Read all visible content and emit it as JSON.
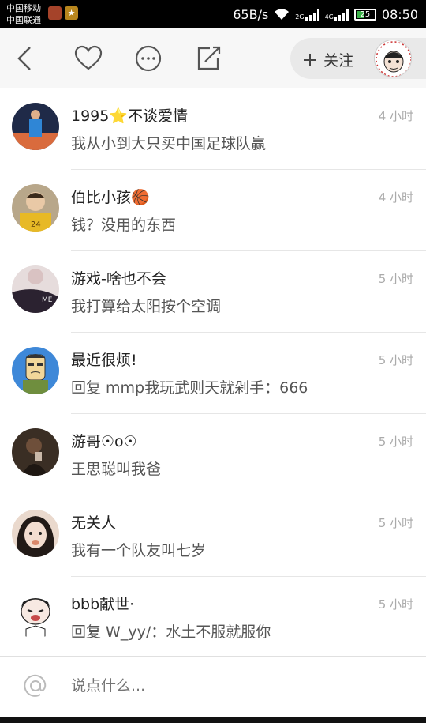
{
  "status_bar": {
    "carrier1": "中国移动",
    "carrier2": "中国联通",
    "speed": "65B/s",
    "net1": "2G",
    "net2": "4G",
    "battery": "25",
    "time": "08:50"
  },
  "header": {
    "follow_label": "关注"
  },
  "comments": [
    {
      "name": "1995⭐不谈爱情",
      "time": "4 小时",
      "message": "我从小到大只买中国足球队赢",
      "avatar_colors": [
        "#3b5a8a",
        "#d96b3d"
      ]
    },
    {
      "name": "伯比小孩🏀",
      "time": "4 小时",
      "message": "钱？没用的东西",
      "avatar_colors": [
        "#c9a86a",
        "#8a7a4e"
      ]
    },
    {
      "name": "游戏-啥也不会",
      "time": "5 小时",
      "message": "我打算给太阳按个空调",
      "avatar_colors": [
        "#e8dede",
        "#3a2a3a"
      ]
    },
    {
      "name": "最近很烦!",
      "time": "5 小时",
      "message": "回复 mmp我玩武则天就剁手：666",
      "avatar_colors": [
        "#3e88d8",
        "#f2d79a"
      ]
    },
    {
      "name": "游哥☉o☉",
      "time": "5 小时",
      "message": "王思聪叫我爸",
      "avatar_colors": [
        "#3a2e24",
        "#7a5a44"
      ]
    },
    {
      "name": "无关人",
      "time": "5 小时",
      "message": "我有一个队友叫七岁",
      "avatar_colors": [
        "#e8d8cc",
        "#2a1e1a"
      ]
    },
    {
      "name": "bbb献世·",
      "time": "5 小时",
      "message": "回复 W_yy/：水土不服就服你",
      "avatar_colors": [
        "#ffffff",
        "#222222"
      ]
    }
  ],
  "input": {
    "placeholder": "说点什么..."
  }
}
